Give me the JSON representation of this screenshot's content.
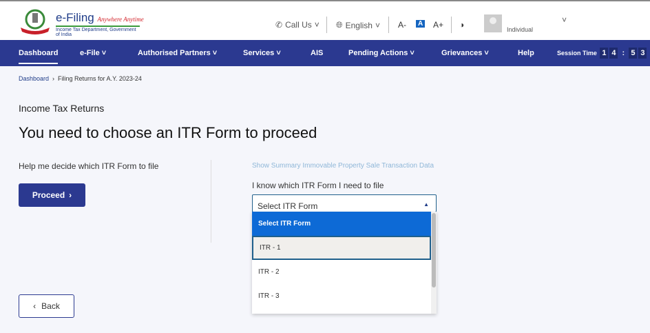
{
  "header": {
    "brand_title": "e-Filing",
    "brand_tagline": "Anywhere Anytime",
    "brand_subtitle": "Income Tax Department, Government of India",
    "call_us": "Call Us",
    "language": "English",
    "font_decrease": "A-",
    "font_default": "A",
    "font_increase": "A+",
    "user_type": "Individual"
  },
  "nav": {
    "items": [
      "Dashboard",
      "e-File",
      "Authorised Partners",
      "Services",
      "AIS",
      "Pending Actions",
      "Grievances",
      "Help"
    ],
    "session_label": "Session Time",
    "session_digits": [
      "1",
      "4",
      ":",
      "5",
      "3"
    ]
  },
  "breadcrumb": {
    "home": "Dashboard",
    "current": "Filing Returns for A.Y. 2023-24"
  },
  "main": {
    "subtitle": "Income Tax Returns",
    "title": "You need to choose an ITR Form to proceed",
    "help_text": "Help me decide which ITR Form to file",
    "proceed": "Proceed",
    "summary_link": "Show Summary Immovable Property Sale Transaction Data",
    "know_label": "I know which ITR Form I need to file",
    "select_value": "Select ITR Form",
    "options": [
      "Select ITR Form",
      "ITR - 1",
      "ITR - 2",
      "ITR - 3"
    ],
    "back": "Back"
  },
  "colors": {
    "nav": "#2b3990",
    "highlight": "#0d6ad6"
  }
}
